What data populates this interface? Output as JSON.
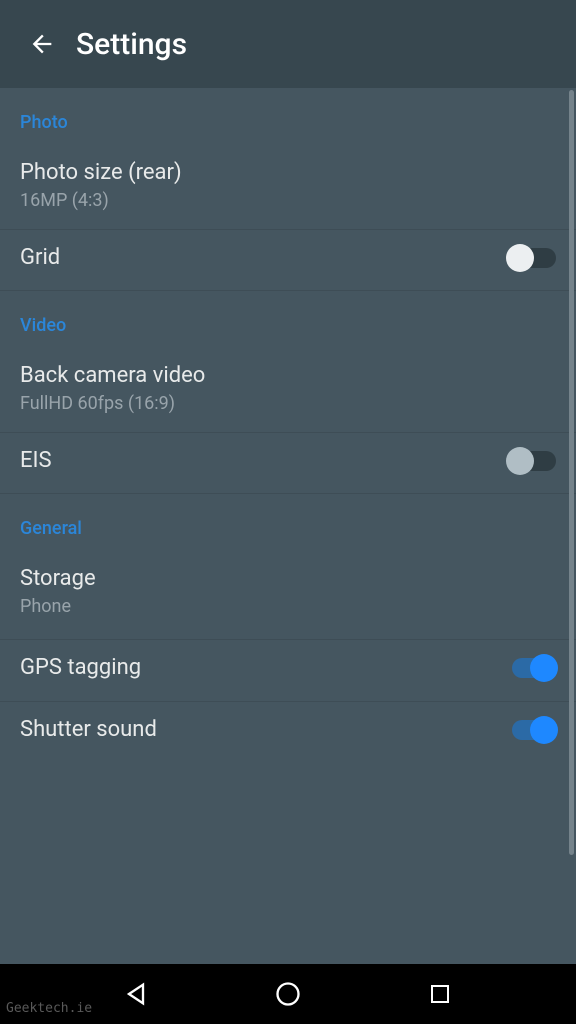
{
  "header": {
    "title": "Settings"
  },
  "sections": {
    "photo": {
      "header": "Photo",
      "photo_size": {
        "title": "Photo size (rear)",
        "subtitle": "16MP (4:3)"
      },
      "grid": {
        "title": "Grid"
      }
    },
    "video": {
      "header": "Video",
      "back_camera": {
        "title": "Back camera video",
        "subtitle": "FullHD 60fps (16:9)"
      },
      "eis": {
        "title": "EIS"
      }
    },
    "general": {
      "header": "General",
      "storage": {
        "title": "Storage",
        "subtitle": "Phone"
      },
      "gps": {
        "title": "GPS tagging"
      },
      "shutter": {
        "title": "Shutter sound"
      }
    }
  },
  "watermark": "Geektech.ie"
}
